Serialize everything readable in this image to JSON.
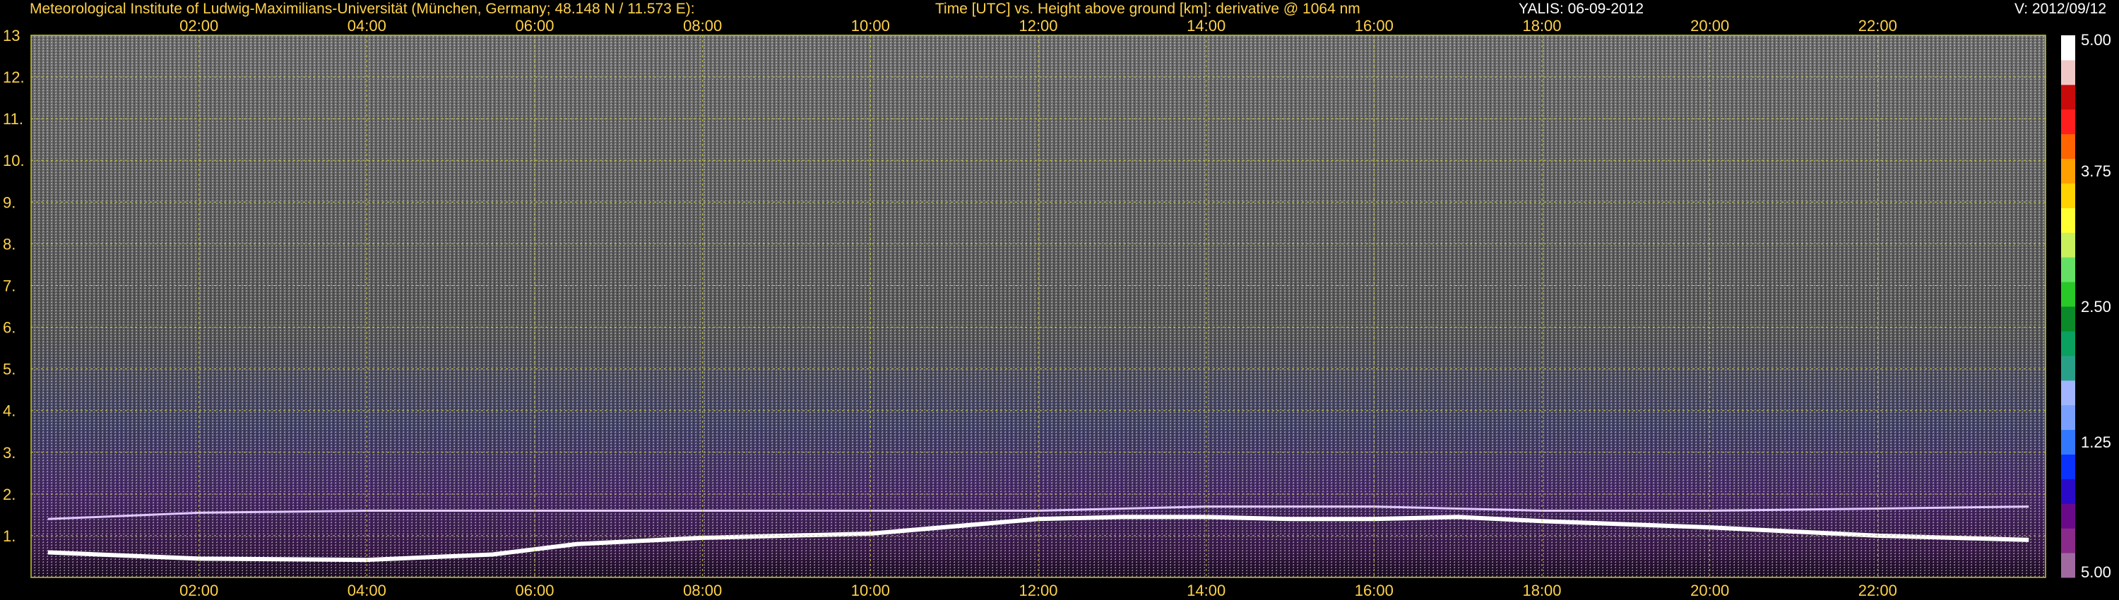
{
  "header": {
    "institute": "Meteorological Institute of Ludwig-Maximilians-Universität (München, Germany; 48.148 N / 11.573 E):",
    "axes_description": "Time [UTC] vs. Height above ground [km]: derivative @ 1064 nm",
    "instrument_date": "YALIS: 06-09-2012",
    "version": "V: 2012/09/12"
  },
  "colors": {
    "background": "#000000",
    "axis_text": "#ffd24a",
    "grid": "#c8c832",
    "header_white": "#ffffff"
  },
  "chart_data": {
    "type": "heatmap",
    "x_ticks": [
      "02:00",
      "04:00",
      "06:00",
      "08:00",
      "10:00",
      "12:00",
      "14:00",
      "16:00",
      "18:00",
      "20:00",
      "22:00"
    ],
    "x_tick_hours": [
      2,
      4,
      6,
      8,
      10,
      12,
      14,
      16,
      18,
      20,
      22
    ],
    "xlim": [
      0,
      24
    ],
    "y_ticks": [
      "1.",
      "2.",
      "3.",
      "4.",
      "5.",
      "6.",
      "7.",
      "8.",
      "9.",
      "10.",
      "11.",
      "12.",
      "13"
    ],
    "y_tick_values": [
      1,
      2,
      3,
      4,
      5,
      6,
      7,
      8,
      9,
      10,
      11,
      12,
      13
    ],
    "ylim": [
      0,
      13
    ],
    "grid": true,
    "colorbar": {
      "tick_labels": [
        "5.00",
        "3.75",
        "2.50",
        "1.25",
        "5.00"
      ],
      "tick_positions": [
        1.0,
        0.75,
        0.5,
        0.25,
        0.0
      ],
      "colors": [
        "#a06aa0",
        "#8a2a8a",
        "#6a0a8a",
        "#2a0ac8",
        "#0a32ff",
        "#3278ff",
        "#7aa0ff",
        "#a0b4ff",
        "#28a088",
        "#0aa060",
        "#0a8a28",
        "#28c828",
        "#64e164",
        "#c8f05a",
        "#ffff32",
        "#ffd200",
        "#ffa000",
        "#ff6400",
        "#ff1e1e",
        "#c80a0a",
        "#f0c8c8",
        "#ffffff"
      ]
    },
    "layers": [
      {
        "name": "",
        "kind": "boundary_layer_top",
        "x_hours": [
          0.2,
          2,
          4,
          5.5,
          6.5,
          8,
          10,
          12,
          13,
          14,
          15,
          16,
          17,
          18,
          20,
          22,
          23.8
        ],
        "y_km": [
          0.6,
          0.45,
          0.42,
          0.55,
          0.8,
          0.95,
          1.05,
          1.4,
          1.45,
          1.45,
          1.4,
          1.4,
          1.45,
          1.35,
          1.2,
          1.0,
          0.9
        ]
      },
      {
        "name": "",
        "kind": "residual_layer",
        "x_hours": [
          0.2,
          2,
          4,
          6.5,
          8,
          10,
          12,
          14,
          16,
          18,
          20,
          22,
          23.8
        ],
        "y_km": [
          1.4,
          1.55,
          1.6,
          1.6,
          1.6,
          1.6,
          1.6,
          1.7,
          1.7,
          1.6,
          1.6,
          1.65,
          1.7
        ]
      }
    ]
  }
}
